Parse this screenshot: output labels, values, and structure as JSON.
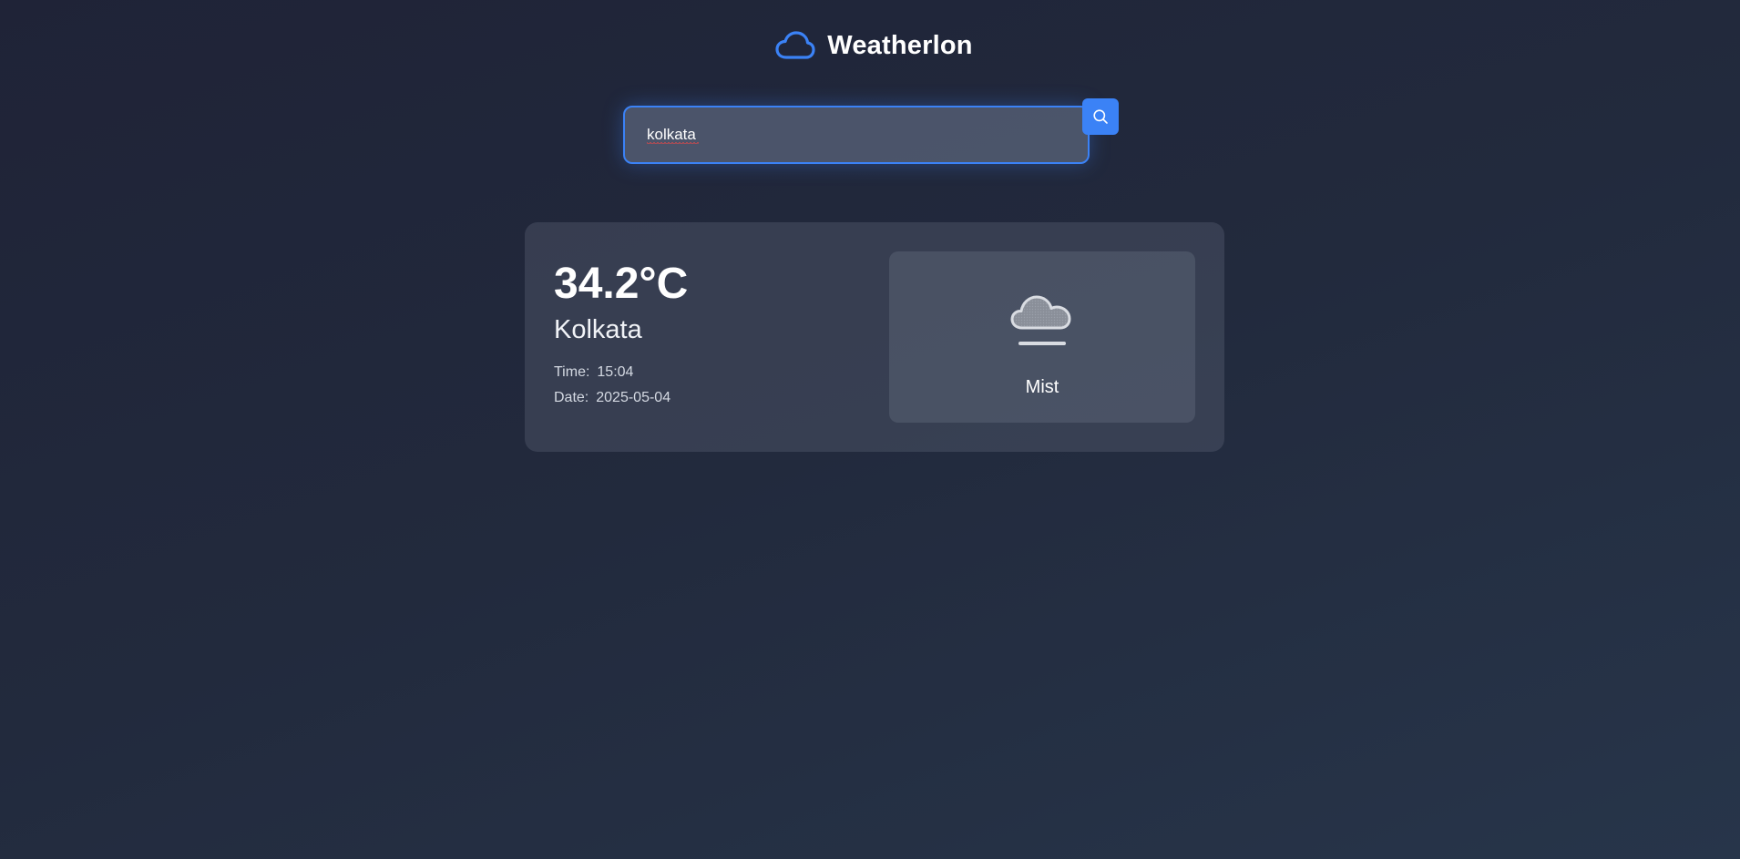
{
  "app": {
    "title": "Weatherlon",
    "logo_icon": "cloud-icon",
    "accent_color": "#3b82f6"
  },
  "search": {
    "value": "kolkata",
    "button_icon": "search-icon"
  },
  "weather": {
    "temperature": "34.2°C",
    "city": "Kolkata",
    "time_label": "Time:",
    "time_value": "15:04",
    "date_label": "Date:",
    "date_value": "2025-05-04",
    "condition": "Mist",
    "condition_icon": "mist-cloud-icon"
  }
}
